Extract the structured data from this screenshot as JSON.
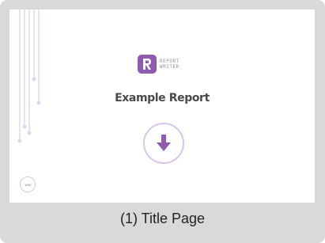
{
  "card": {
    "caption": "(1) Title Page"
  },
  "slide": {
    "logo_icon": "report-r-logo-icon",
    "logo_text_line1": "REPORT",
    "logo_text_line2": "WRITER",
    "title": "Example Report",
    "download_icon": "arrow-down-icon",
    "page_badge": "1/30"
  },
  "colors": {
    "accent": "#8e5bb0",
    "accent_light": "#d7c5ea",
    "card_bg": "#d9d9d9"
  }
}
